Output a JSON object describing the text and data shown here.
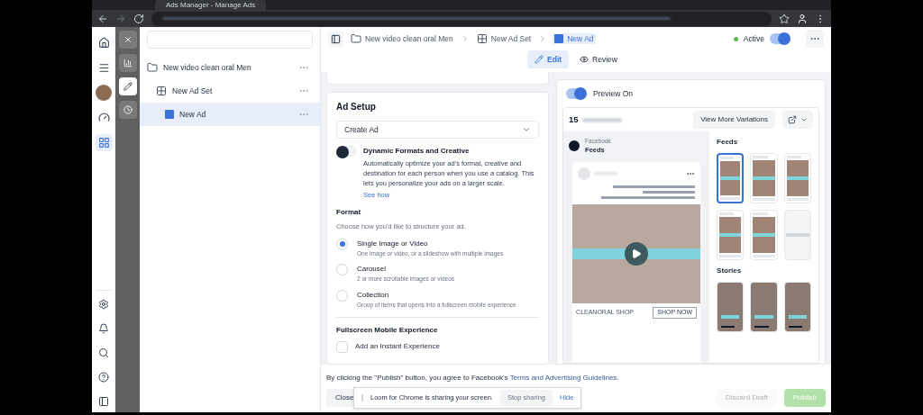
{
  "browser": {
    "tab_title": "Ads Manager - Manage Ads"
  },
  "rail": {
    "items": [
      {
        "kind": "home",
        "selected": false
      },
      {
        "kind": "menu",
        "selected": false
      },
      {
        "kind": "avatar",
        "selected": false
      },
      {
        "kind": "gauge",
        "selected": false
      },
      {
        "kind": "grid",
        "selected": true
      }
    ],
    "bottom": [
      {
        "kind": "settings"
      },
      {
        "kind": "bell"
      },
      {
        "kind": "search"
      },
      {
        "kind": "help"
      },
      {
        "kind": "panel"
      }
    ]
  },
  "tools": [
    {
      "kind": "close",
      "selected": false
    },
    {
      "kind": "chart",
      "selected": false
    },
    {
      "kind": "edit",
      "selected": true
    },
    {
      "kind": "history",
      "selected": false
    }
  ],
  "tree": [
    {
      "kind": "campaign",
      "label": "New video clean oral Men",
      "selected": false,
      "children": [
        {
          "kind": "adset",
          "label": "New Ad Set",
          "selected": false,
          "children": [
            {
              "kind": "ad",
              "label": "New Ad",
              "selected": true
            }
          ]
        }
      ]
    }
  ],
  "breadcrumb": [
    {
      "kind": "campaign",
      "label": "New video clean oral Men",
      "selected": false
    },
    {
      "kind": "adset",
      "label": "New Ad Set",
      "selected": false
    },
    {
      "kind": "ad",
      "label": "New Ad",
      "selected": true
    }
  ],
  "status": {
    "label": "Active",
    "on": true
  },
  "modes": [
    {
      "kind": "edit",
      "label": "Edit",
      "selected": true
    },
    {
      "kind": "review",
      "label": "Review",
      "selected": false
    }
  ],
  "ad_setup": {
    "title": "Ad Setup",
    "dropdown": "Create Ad",
    "dynamic": {
      "title": "Dynamic Formats and Creative",
      "on": false,
      "description": "Automatically optimize your ad's format, creative and destination for each person when you use a catalog. This lets you personalize your ads on a larger scale.",
      "link": "See how"
    },
    "format": {
      "title": "Format",
      "hint": "Choose how you'd like to structure your ad.",
      "options": [
        {
          "label": "Single Image or Video",
          "description": "One image or video, or a slideshow with multiple images",
          "selected": true
        },
        {
          "label": "Carousel",
          "description": "2 or more scrollable images or videos",
          "selected": false
        },
        {
          "label": "Collection",
          "description": "Group of items that opens into a fullscreen mobile experience",
          "selected": false
        }
      ]
    },
    "fullscreen": {
      "title": "Fullscreen Mobile Experience",
      "checkbox_label": "Add an Instant Experience",
      "checked": false
    }
  },
  "preview": {
    "toggle_label": "Preview On",
    "on": true,
    "placements_count": "15",
    "view_more": "View More Variations",
    "platform": "Facebook",
    "placement": "Feeds",
    "ad": {
      "shop": "CLEANORAL SHOP",
      "cta": "SHOP NOW"
    },
    "groups": [
      {
        "title": "Feeds",
        "thumbs": [
          {
            "kind": "post",
            "selected": true
          },
          {
            "kind": "post",
            "selected": false
          },
          {
            "kind": "post",
            "selected": false
          },
          {
            "kind": "post",
            "selected": false
          },
          {
            "kind": "post",
            "selected": false
          },
          {
            "kind": "banner",
            "selected": false
          }
        ]
      },
      {
        "title": "Stories",
        "thumbs": [
          {
            "kind": "story",
            "selected": false
          },
          {
            "kind": "story",
            "selected": false
          },
          {
            "kind": "story",
            "selected": false
          }
        ]
      }
    ]
  },
  "footer": {
    "terms": "By clicking the \"Publish\" button, you agree to Facebook's",
    "terms_link": "Terms and Advertising Guidelines",
    "terms_end": ".",
    "buttons": [
      {
        "kind": "close",
        "label": "Close",
        "disabled": false
      },
      {
        "kind": "discard",
        "label": "Discard Draft",
        "disabled": true
      },
      {
        "kind": "publish",
        "label": "Publish",
        "disabled": true
      }
    ]
  },
  "screen_share": {
    "message": "Loom for Chrome is sharing your screen.",
    "stop": "Stop sharing",
    "hide": "Hide"
  }
}
